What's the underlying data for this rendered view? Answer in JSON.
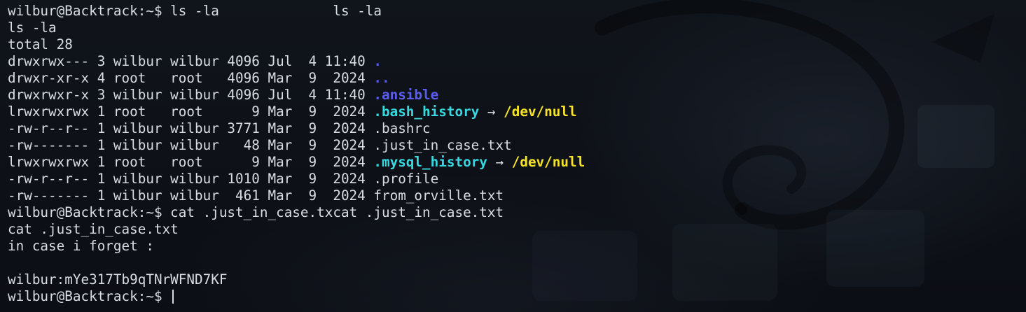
{
  "prompt": "wilbur@Backtrack:~$ ",
  "lines": [
    {
      "kind": "cmd",
      "cmd": "ls -la",
      "echo": "              ls -la"
    },
    {
      "kind": "text",
      "text": "ls -la"
    },
    {
      "kind": "text",
      "text": "total 28"
    },
    {
      "kind": "entry",
      "prefix": "drwxrwx--- 3 wilbur wilbur 4096 Jul  4 11:40 ",
      "name": ".",
      "style": "dir"
    },
    {
      "kind": "entry",
      "prefix": "drwxr-xr-x 4 root   root   4096 Mar  9  2024 ",
      "name": "..",
      "style": "dir"
    },
    {
      "kind": "entry",
      "prefix": "drwxrwxr-x 3 wilbur wilbur 4096 Jul  4 11:40 ",
      "name": ".ansible",
      "style": "dir"
    },
    {
      "kind": "entry",
      "prefix": "lrwxrwxrwx 1 root   root      9 Mar  9  2024 ",
      "name": ".bash_history",
      "style": "lnk",
      "arrow": " → ",
      "target": "/dev/null"
    },
    {
      "kind": "entry",
      "prefix": "-rw-r--r-- 1 wilbur wilbur 3771 Mar  9  2024 ",
      "name": ".bashrc",
      "style": "file"
    },
    {
      "kind": "entry",
      "prefix": "-rw------- 1 wilbur wilbur   48 Mar  9  2024 ",
      "name": ".just_in_case.txt",
      "style": "file"
    },
    {
      "kind": "entry",
      "prefix": "lrwxrwxrwx 1 root   root      9 Mar  9  2024 ",
      "name": ".mysql_history",
      "style": "lnk",
      "arrow": " → ",
      "target": "/dev/null"
    },
    {
      "kind": "entry",
      "prefix": "-rw-r--r-- 1 wilbur wilbur 1010 Mar  9  2024 ",
      "name": ".profile",
      "style": "file"
    },
    {
      "kind": "entry",
      "prefix": "-rw------- 1 wilbur wilbur  461 Mar  9  2024 ",
      "name": "from_orville.txt",
      "style": "file"
    },
    {
      "kind": "cmd",
      "cmd": "cat .just_in_case.txcat .just_in_case.txt",
      "echo": ""
    },
    {
      "kind": "text",
      "text": "cat .just_in_case.txt"
    },
    {
      "kind": "text",
      "text": "in case i forget :"
    },
    {
      "kind": "text",
      "text": ""
    },
    {
      "kind": "text",
      "text": "wilbur:mYe317Tb9qTNrWFND7KF"
    },
    {
      "kind": "cmd",
      "cmd": "",
      "echo": "",
      "cursor": true
    }
  ],
  "colors": {
    "background": "#0d1017",
    "foreground": "#d8dce4",
    "directory": "#5a5cf2",
    "symlink": "#38d8e0",
    "link_target": "#f5e22a"
  }
}
